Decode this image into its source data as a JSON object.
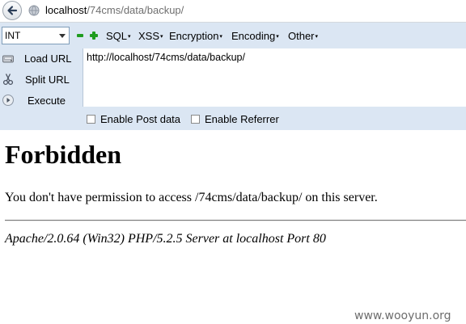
{
  "browser": {
    "address": {
      "host": "localhost",
      "path": "/74cms/data/backup/"
    }
  },
  "hackbar": {
    "select_value": "INT",
    "menus": [
      {
        "label": "SQL",
        "arrow": "▾"
      },
      {
        "label": "XSS",
        "arrow": "▾"
      },
      {
        "label": "Encryption",
        "arrow": "▾"
      },
      {
        "label": "Encoding",
        "arrow": "▾"
      },
      {
        "label": "Other",
        "arrow": "▾"
      }
    ],
    "actions": {
      "load_url": "Load URL",
      "split_url": "Split URL",
      "execute": "Execute"
    },
    "url_value": "http://localhost/74cms/data/backup/",
    "checkboxes": {
      "post_data": "Enable Post data",
      "referrer": "Enable Referrer"
    }
  },
  "page": {
    "title": "Forbidden",
    "message": "You don't have permission to access /74cms/data/backup/ on this server.",
    "address": "Apache/2.0.64 (Win32) PHP/5.2.5 Server at localhost Port 80"
  },
  "watermark": "www.wooyun.org",
  "colors": {
    "hackbar_bg": "#dbe6f3",
    "plus_minus_green": "#1f9c1f"
  }
}
